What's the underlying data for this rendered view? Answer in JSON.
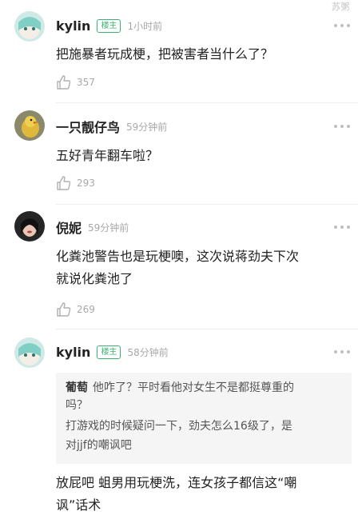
{
  "watermark": "苏粥",
  "comments": [
    {
      "user": "kylin",
      "badge": "楼主",
      "time": "1小时前",
      "lines": [
        "把施暴者玩成梗，把被害者当什么了？"
      ],
      "likes": "357"
    },
    {
      "user": "一只靓仔鸟",
      "time": "59分钟前",
      "lines": [
        "五好青年翻车啦？"
      ],
      "likes": "293"
    },
    {
      "user": "倪妮",
      "time": "59分钟前",
      "lines": [
        "化粪池警告也是玩梗噢，这次说蒋劲夫下次",
        "就说化粪池了"
      ],
      "likes": "269"
    },
    {
      "user": "kylin",
      "badge": "楼主",
      "time": "58分钟前",
      "quote": {
        "author": "葡萄",
        "lines": [
          "他咋了？平时看他对女生不是都挺尊重的",
          "吗？",
          "打游戏的时候疑问一下，劲夫怎么16级了，是",
          "对jjf的嘲讽吧"
        ]
      },
      "lines": [
        "放屁吧 蛆男用玩梗洗，连女孩子都信这“嘲",
        "讽”话术"
      ]
    }
  ]
}
